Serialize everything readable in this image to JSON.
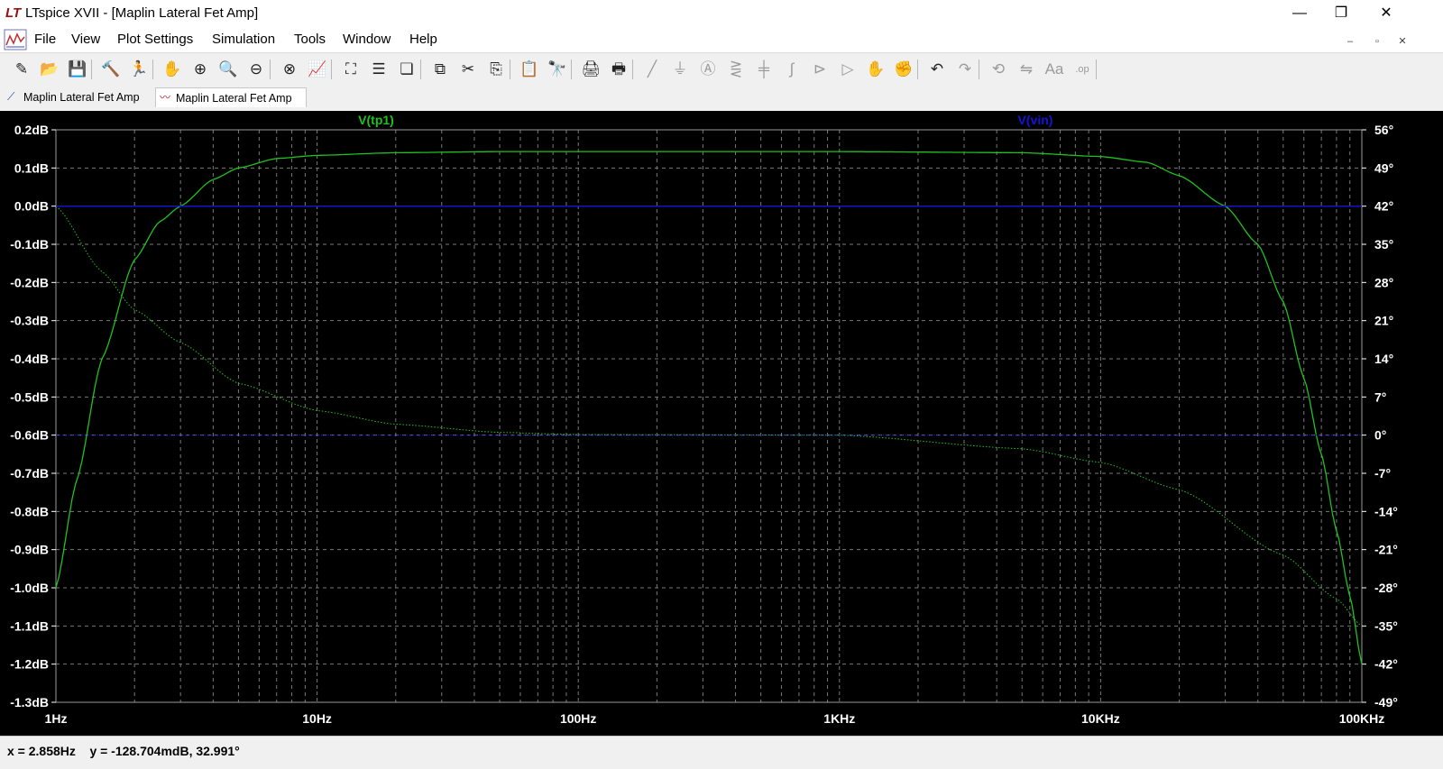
{
  "window": {
    "title": "LTspice XVII - [Maplin Lateral Fet Amp]",
    "app_icon": "LT",
    "minimize": "—",
    "maximize": "❐",
    "close": "✕"
  },
  "menu": {
    "items": [
      "File",
      "View",
      "Plot Settings",
      "Simulation",
      "Tools",
      "Window",
      "Help"
    ],
    "mdi_minimize": "–",
    "mdi_restore": "▫",
    "mdi_close": "✕"
  },
  "toolbar": {
    "icons": [
      {
        "name": "open-schematic-icon",
        "glyph": "✎",
        "enabled": true
      },
      {
        "name": "open-file-icon",
        "glyph": "📂",
        "enabled": true
      },
      {
        "name": "save-icon",
        "glyph": "💾",
        "enabled": true
      },
      {
        "name": "control-panel-icon",
        "glyph": "🔨",
        "enabled": true
      },
      {
        "name": "run-icon",
        "glyph": "🏃",
        "enabled": true
      },
      {
        "name": "halt-icon",
        "glyph": "✋",
        "enabled": false
      },
      {
        "name": "zoom-in-icon",
        "glyph": "⊕",
        "enabled": true
      },
      {
        "name": "zoom-pan-icon",
        "glyph": "🔍",
        "enabled": true
      },
      {
        "name": "zoom-out-icon",
        "glyph": "⊖",
        "enabled": true
      },
      {
        "name": "zoom-cancel-icon",
        "glyph": "⊗",
        "enabled": true
      },
      {
        "name": "autorange-icon",
        "glyph": "📈",
        "enabled": true
      },
      {
        "name": "fit-icon",
        "glyph": "⛶",
        "enabled": true
      },
      {
        "name": "tile-horizontal-icon",
        "glyph": "☰",
        "enabled": true
      },
      {
        "name": "cascade-icon",
        "glyph": "❏",
        "enabled": true
      },
      {
        "name": "tile-vertical-icon",
        "glyph": "⧉",
        "enabled": true
      },
      {
        "name": "cut-icon",
        "glyph": "✂",
        "enabled": true
      },
      {
        "name": "copy-icon",
        "glyph": "⎘",
        "enabled": true
      },
      {
        "name": "paste-icon",
        "glyph": "📋",
        "enabled": true
      },
      {
        "name": "find-icon",
        "glyph": "🔭",
        "enabled": true
      },
      {
        "name": "print-icon",
        "glyph": "🖨",
        "enabled": true
      },
      {
        "name": "print-preview-icon",
        "glyph": "🖶",
        "enabled": true
      },
      {
        "name": "wire-icon",
        "glyph": "╱",
        "enabled": false
      },
      {
        "name": "ground-icon",
        "glyph": "⏚",
        "enabled": false
      },
      {
        "name": "label-net-icon",
        "glyph": "Ⓐ",
        "enabled": false
      },
      {
        "name": "resistor-icon",
        "glyph": "⋛",
        "enabled": false
      },
      {
        "name": "capacitor-icon",
        "glyph": "╪",
        "enabled": false
      },
      {
        "name": "inductor-icon",
        "glyph": "∫",
        "enabled": false
      },
      {
        "name": "diode-icon",
        "glyph": "⊳",
        "enabled": false
      },
      {
        "name": "component-icon",
        "glyph": "▷",
        "enabled": false
      },
      {
        "name": "move-icon",
        "glyph": "✋",
        "enabled": false
      },
      {
        "name": "drag-icon",
        "glyph": "✊",
        "enabled": false
      },
      {
        "name": "undo-icon",
        "glyph": "↶",
        "enabled": true
      },
      {
        "name": "redo-icon",
        "glyph": "↷",
        "enabled": false
      },
      {
        "name": "rotate-icon",
        "glyph": "⟲",
        "enabled": false
      },
      {
        "name": "mirror-icon",
        "glyph": "⇋",
        "enabled": false
      },
      {
        "name": "text-icon",
        "glyph": "Aa",
        "enabled": false
      },
      {
        "name": "spice-directive-icon",
        "glyph": ".op",
        "enabled": false
      }
    ]
  },
  "tabs": [
    {
      "label": "Maplin Lateral Fet Amp",
      "icon": "schematic-icon",
      "active": false
    },
    {
      "label": "Maplin Lateral Fet Amp",
      "icon": "waveform-icon",
      "active": true
    }
  ],
  "plot": {
    "traces": [
      {
        "label": "V(tp1)",
        "color": "#1fc11f"
      },
      {
        "label": "V(vin)",
        "color": "#1010d0"
      }
    ],
    "colors": {
      "background": "#000000",
      "grid": "#808080",
      "axis_text": "#ffffff",
      "magnitude": "#1fc11f",
      "vin": "#1414d8"
    }
  },
  "chart_data": {
    "type": "line",
    "x_scale": "log",
    "x_range": [
      1,
      100000
    ],
    "x_unit": "Hz",
    "x_ticks": [
      "1Hz",
      "10Hz",
      "100Hz",
      "1KHz",
      "10KHz",
      "100KHz"
    ],
    "y_left_range": [
      -1.3,
      0.2
    ],
    "y_left_ticks": [
      "0.2dB",
      "0.1dB",
      "0.0dB",
      "-0.1dB",
      "-0.2dB",
      "-0.3dB",
      "-0.4dB",
      "-0.5dB",
      "-0.6dB",
      "-0.7dB",
      "-0.8dB",
      "-0.9dB",
      "-1.0dB",
      "-1.1dB",
      "-1.2dB",
      "-1.3dB"
    ],
    "y_right_range": [
      -49,
      56
    ],
    "y_right_ticks": [
      "56°",
      "49°",
      "42°",
      "35°",
      "28°",
      "21°",
      "14°",
      "7°",
      "0°",
      "-7°",
      "-14°",
      "-21°",
      "-28°",
      "-35°",
      "-42°",
      "-49°"
    ],
    "grid": true,
    "series": [
      {
        "name": "V(tp1)",
        "quantity": "magnitude_dB",
        "x": [
          1,
          1.2,
          1.5,
          2,
          2.5,
          3,
          4,
          5,
          7,
          10,
          20,
          50,
          100,
          1000,
          5000,
          10000,
          15000,
          20000,
          30000,
          40000,
          50000,
          60000,
          70000,
          80000,
          90000,
          100000
        ],
        "y": [
          -1.0,
          -0.72,
          -0.4,
          -0.14,
          -0.04,
          0.0,
          0.07,
          0.1,
          0.125,
          0.133,
          0.14,
          0.143,
          0.143,
          0.143,
          0.14,
          0.13,
          0.115,
          0.08,
          0.0,
          -0.1,
          -0.25,
          -0.45,
          -0.65,
          -0.85,
          -1.02,
          -1.2
        ]
      },
      {
        "name": "V(tp1)",
        "quantity": "phase_deg",
        "line_style": "dotted",
        "x": [
          1,
          1.5,
          2,
          3,
          5,
          10,
          20,
          50,
          100,
          1000,
          5000,
          10000,
          20000,
          50000,
          80000,
          100000
        ],
        "y": [
          42,
          30,
          23,
          17,
          9.5,
          4.5,
          2,
          0.5,
          0.1,
          0,
          -2.5,
          -5,
          -10,
          -22,
          -30,
          -35
        ]
      },
      {
        "name": "V(vin)",
        "quantity": "magnitude_dB",
        "x": [
          1,
          100000
        ],
        "y": [
          0,
          0
        ]
      },
      {
        "name": "V(vin)",
        "quantity": "phase_deg",
        "line_style": "dotted",
        "x": [
          1,
          100000
        ],
        "y": [
          0,
          0
        ]
      }
    ]
  },
  "status": {
    "readout": "x = 2.858Hz    y = -128.704mdB, 32.991°"
  }
}
